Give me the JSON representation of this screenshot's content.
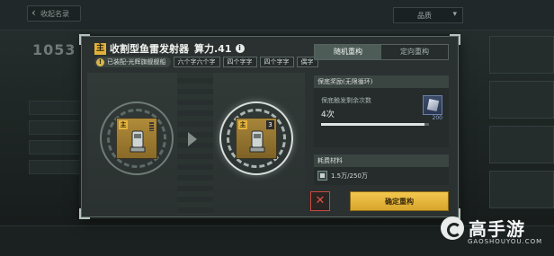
{
  "background": {
    "back_label": "收起名录",
    "dropdown_label": "品质",
    "score": "1053",
    "rows": [
      "",
      "",
      "",
      ""
    ]
  },
  "modal": {
    "rank_tag": "主",
    "title": "收割型鱼雷发射器",
    "power": "算力.41",
    "equipped_label": "已装配-光辉旗舰舰船",
    "chips": [
      "六个字六个字",
      "四个字字",
      "四个字字",
      "偶字"
    ],
    "left_card": {
      "tag": "主",
      "level": ""
    },
    "right_card": {
      "tag": "主",
      "level": "3"
    },
    "tabs": [
      {
        "label": "随机重构",
        "active": true
      },
      {
        "label": "定向重构",
        "active": false
      }
    ],
    "guarantee": {
      "header": "保底奖励(无限循环)",
      "label": "保底触发剩余次数",
      "count": "4次",
      "progress": 0.96,
      "item_count": "200"
    },
    "cost": {
      "header": "耗费材料",
      "value": "1.5万/250万"
    },
    "cancel_symbol": "✕",
    "confirm_label": "确定重构"
  },
  "brand": {
    "name": "高手游",
    "url": "GAOSHOUYOU.COM"
  },
  "colors": {
    "accent_gold": "#e2b13a",
    "confirm_button": "#f0c14a",
    "cancel_red": "#e05346",
    "active_tab": "#4e5c58"
  }
}
